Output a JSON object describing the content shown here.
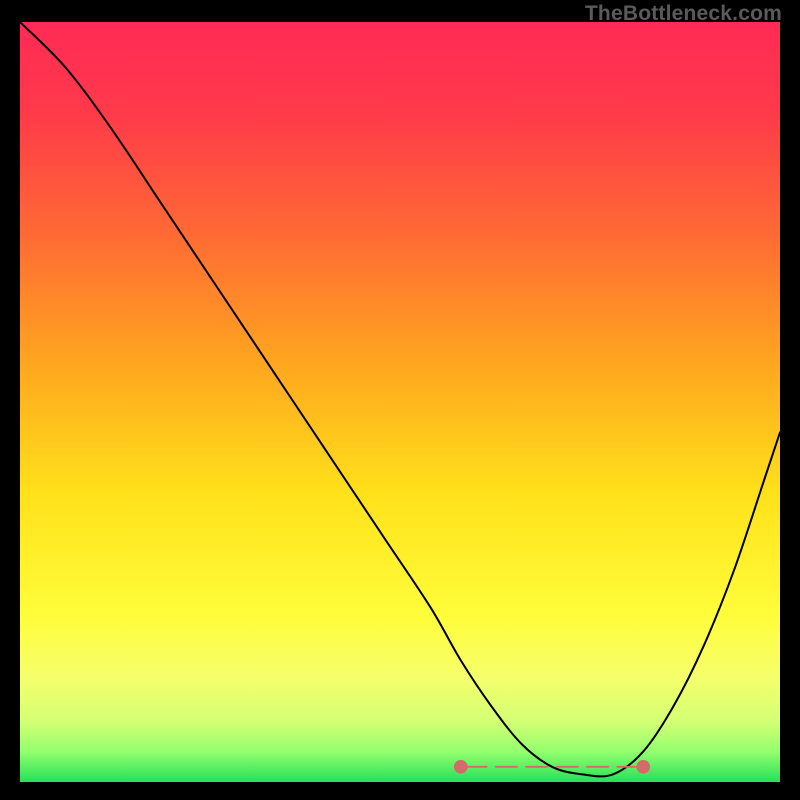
{
  "watermark": "TheBottleneck.com",
  "colors": {
    "curve": "#000000",
    "marker": "#d46a6a",
    "gradient_stops": [
      {
        "offset": 0.0,
        "color": "#ff2a55"
      },
      {
        "offset": 0.12,
        "color": "#ff3a4a"
      },
      {
        "offset": 0.28,
        "color": "#ff6a34"
      },
      {
        "offset": 0.45,
        "color": "#ffa61f"
      },
      {
        "offset": 0.62,
        "color": "#ffe11a"
      },
      {
        "offset": 0.78,
        "color": "#fffd3a"
      },
      {
        "offset": 0.86,
        "color": "#f6ff6a"
      },
      {
        "offset": 0.92,
        "color": "#d4ff74"
      },
      {
        "offset": 0.96,
        "color": "#93ff6e"
      },
      {
        "offset": 1.0,
        "color": "#26e05a"
      }
    ]
  },
  "chart_data": {
    "type": "line",
    "title": "",
    "xlabel": "",
    "ylabel": "",
    "xlim": [
      0,
      100
    ],
    "ylim": [
      0,
      100
    ],
    "grid": false,
    "legend": null,
    "series": [
      {
        "name": "bottleneck_curve",
        "x": [
          0,
          6,
          12,
          18,
          24,
          30,
          36,
          42,
          48,
          54,
          58,
          62,
          66,
          70,
          74,
          78,
          82,
          86,
          90,
          94,
          98,
          100
        ],
        "y": [
          100,
          94,
          86,
          77,
          68,
          59,
          50,
          41,
          32,
          23,
          16,
          10,
          5,
          2,
          1,
          1,
          4,
          10,
          18,
          28,
          40,
          46
        ]
      }
    ],
    "optimal_range_x": [
      58,
      82
    ],
    "optimal_markers_x": [
      58,
      62,
      66,
      70,
      74,
      78,
      82
    ],
    "optimal_y": 2
  }
}
